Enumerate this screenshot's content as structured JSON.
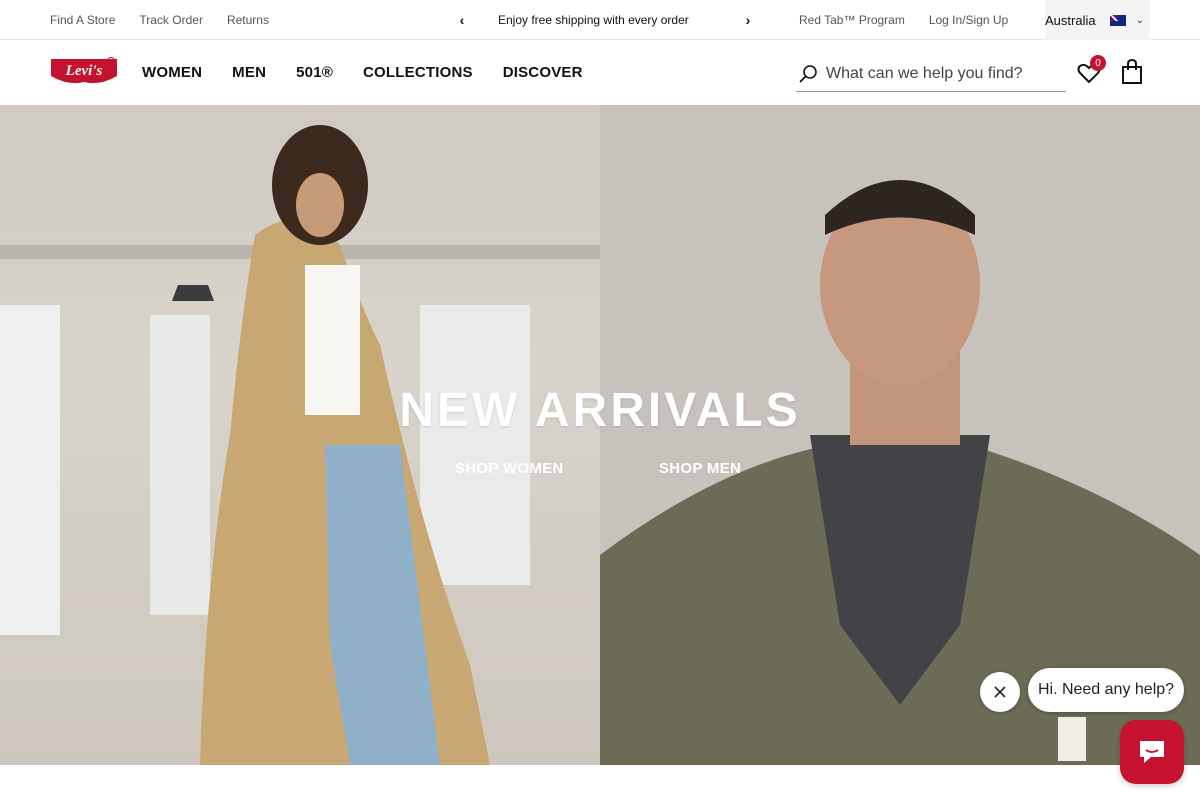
{
  "utility": {
    "links_left": [
      "Find A Store",
      "Track Order",
      "Returns"
    ],
    "promo_text": "Enjoy free shipping with every order",
    "links_right": [
      "Red Tab™ Program",
      "Log In/Sign Up"
    ],
    "country": "Australia"
  },
  "nav": {
    "items": [
      "WOMEN",
      "MEN",
      "501®",
      "COLLECTIONS",
      "DISCOVER"
    ],
    "search_placeholder": "What can we help you find?",
    "wishlist_count": "0"
  },
  "hero": {
    "title": "NEW ARRIVALS",
    "shop_women": "SHOP WOMEN",
    "shop_men": "SHOP MEN"
  },
  "chat": {
    "greeting": "Hi. Need any help?"
  },
  "colors": {
    "brand_red": "#c41230"
  }
}
